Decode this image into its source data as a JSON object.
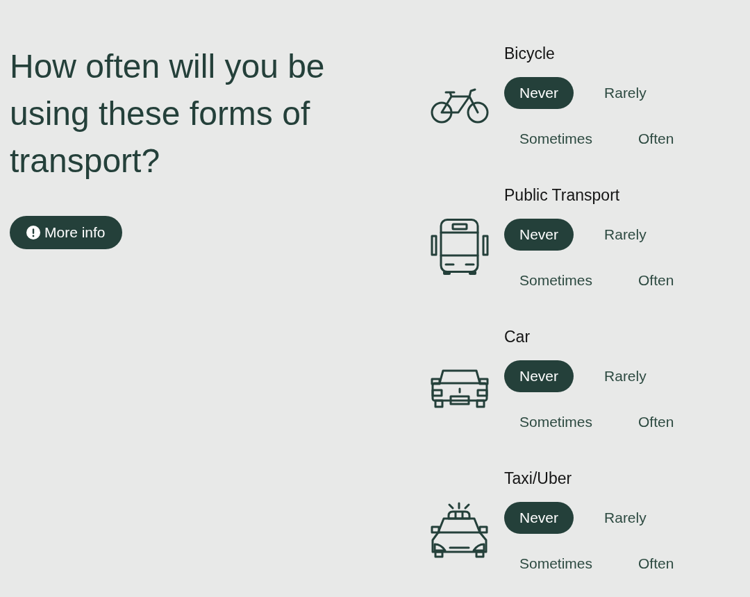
{
  "question": {
    "text": "How often will you be using these forms of transport?"
  },
  "more_info_button": {
    "label": "More info"
  },
  "transport_modes": [
    {
      "name": "Bicycle",
      "kind": "bicycle",
      "options": [
        {
          "label": "Never",
          "selected": true
        },
        {
          "label": "Rarely",
          "selected": false
        },
        {
          "label": "Sometimes",
          "selected": false
        },
        {
          "label": "Often",
          "selected": false
        }
      ]
    },
    {
      "name": "Public Transport",
      "kind": "bus",
      "options": [
        {
          "label": "Never",
          "selected": true
        },
        {
          "label": "Rarely",
          "selected": false
        },
        {
          "label": "Sometimes",
          "selected": false
        },
        {
          "label": "Often",
          "selected": false
        }
      ]
    },
    {
      "name": "Car",
      "kind": "car",
      "options": [
        {
          "label": "Never",
          "selected": true
        },
        {
          "label": "Rarely",
          "selected": false
        },
        {
          "label": "Sometimes",
          "selected": false
        },
        {
          "label": "Often",
          "selected": false
        }
      ]
    },
    {
      "name": "Taxi/Uber",
      "kind": "taxi",
      "options": [
        {
          "label": "Never",
          "selected": true
        },
        {
          "label": "Rarely",
          "selected": false
        },
        {
          "label": "Sometimes",
          "selected": false
        },
        {
          "label": "Often",
          "selected": false
        }
      ]
    }
  ]
}
